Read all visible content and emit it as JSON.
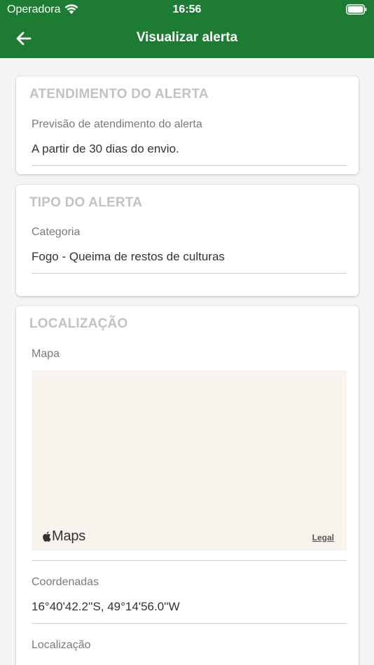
{
  "status_bar": {
    "carrier": "Operadora",
    "time": "16:56"
  },
  "nav": {
    "title": "Visualizar alerta"
  },
  "cards": {
    "atendimento": {
      "title": "ATENDIMENTO DO ALERTA",
      "label": "Previsão de atendimento do alerta",
      "value": "A partir de 30 dias do envio."
    },
    "tipo": {
      "title": "TIPO DO ALERTA",
      "label": "Categoria",
      "value": "Fogo - Queima de restos de culturas"
    },
    "localizacao": {
      "title": "LOCALIZAÇÃO",
      "map_label": "Mapa",
      "maps_brand": "Maps",
      "legal": "Legal",
      "coords_label": "Coordenadas",
      "coords_value": "16°40'42.2''S, 49°14'56.0''W",
      "location_label": "Localização"
    }
  },
  "colors": {
    "header": "#1e7b34",
    "map_background": "#f8f4ed",
    "card_title": "#c2c2c2"
  }
}
